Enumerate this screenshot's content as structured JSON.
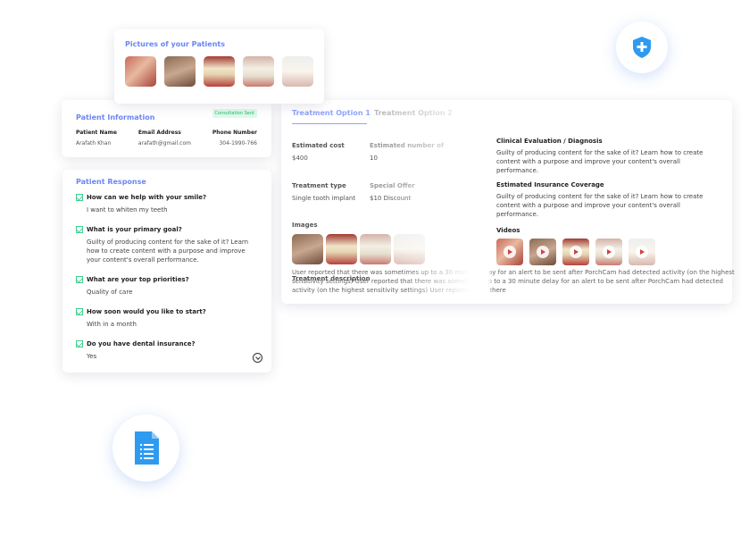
{
  "pictures": {
    "title": "Pictures of your Patients"
  },
  "patient_info": {
    "title": "Patient Information",
    "badge": "Consultation Sent",
    "headers": [
      "Patient Name",
      "Email Address",
      "Phone Number"
    ],
    "values": [
      "Arafath Khan",
      "arafath@gmail.com",
      "304-1990-766"
    ]
  },
  "response": {
    "title": "Patient Response",
    "items": [
      {
        "q": "How can we help with your smile?",
        "a": "I want to whiten my teeth"
      },
      {
        "q": "What is your primary goal?",
        "a": "Guilty of producing content for the sake of it? Learn how to create content with a purpose and improve your content's overall performance."
      },
      {
        "q": "What are your top priorities?",
        "a": "Quality of care"
      },
      {
        "q": "How soon would you like to start?",
        "a": "With in a month"
      },
      {
        "q": "Do you have dental insurance?",
        "a": "Yes"
      }
    ]
  },
  "treatment": {
    "tabs": [
      "Treatment Option 1",
      "Treatment Option 2"
    ],
    "cost_label": "Estimated cost",
    "cost": "$400",
    "num_label": "Estimated number of",
    "num": "10",
    "type_label": "Treatment type",
    "type": "Single tooth implant",
    "offer_label": "Special Offer",
    "offer": "$10 Discount",
    "images_label": "Images",
    "desc_label": "Treatment description",
    "desc": "User reported that there was sometimes up to a 30 minute delay for an alert to be sent after PorchCam had detected activity (on the highest sensitivity settings) User reported that there was sometimes up to a 30 minute delay for an alert to be sent after PorchCam had detected activity (on the highest sensitivity settings) User reported that there",
    "clinical_label": "Clinical Evaluation / Diagnosis",
    "clinical": "Guilty of producing content for the sake of it? Learn how to create content with a purpose and improve your content's overall performance.",
    "insurance_label": "Estimated Insurance Coverage",
    "insurance": "Guilty of producing content for the sake of it? Learn how to create content with a purpose and improve your content's overall performance.",
    "videos_label": "Videos"
  },
  "colors": {
    "accent": "#6a86f5",
    "success": "#3fcf8e",
    "shield": "#2f9bf0"
  }
}
